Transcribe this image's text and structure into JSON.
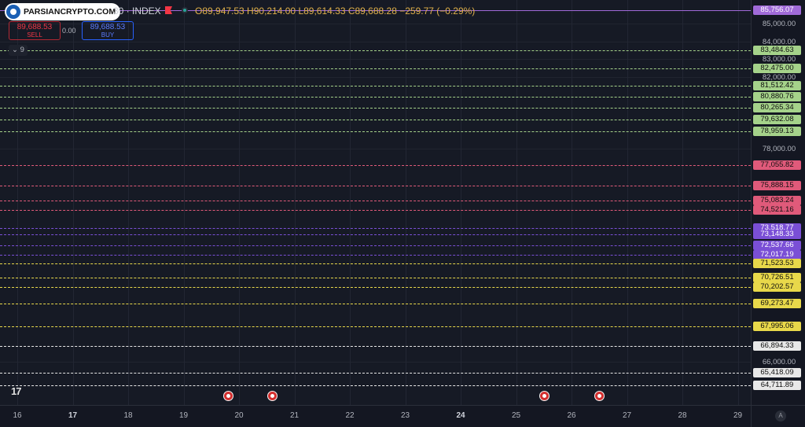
{
  "header": {
    "brand": "PARSIANCRYPTO.COM",
    "symbol": "30 · INDEX",
    "ohlc": "O89,947.53 H90,214.00 L89,614.33 C89,688.28 −259.77 (−0.29%)"
  },
  "trade": {
    "sell_price": "89,688.53",
    "sell_label": "SELL",
    "spread": "0.00",
    "buy_price": "89,688.53",
    "buy_label": "BUY",
    "collapse_count": "9"
  },
  "price_axis": {
    "min": 64250,
    "max": 86150,
    "ticks": [
      "85,000.00",
      "84,000.00",
      "83,000.00",
      "82,000.00",
      "78,000.00",
      "66,000.00"
    ],
    "tick_values": [
      85000,
      84000,
      83000,
      82000,
      78000,
      66000
    ]
  },
  "levels": [
    {
      "label": "85,756.07",
      "value": 85756.07,
      "color": "#a06ad8",
      "style": "solid"
    },
    {
      "label": "83,484.63",
      "value": 83484.63,
      "color": "#a5d28a"
    },
    {
      "label": "82,475.00",
      "value": 82475.0,
      "color": "#a5d28a"
    },
    {
      "label": "81,512.42",
      "value": 81512.42,
      "color": "#a5d28a"
    },
    {
      "label": "80,880.76",
      "value": 80880.76,
      "color": "#a5d28a"
    },
    {
      "label": "80,265.34",
      "value": 80265.34,
      "color": "#a5d28a"
    },
    {
      "label": "79,632.08",
      "value": 79632.08,
      "color": "#a5d28a"
    },
    {
      "label": "78,959.13",
      "value": 78959.13,
      "color": "#a5d28a"
    },
    {
      "label": "77,055.82",
      "value": 77055.82,
      "color": "#e05a7a"
    },
    {
      "label": "75,888.15",
      "value": 75888.15,
      "color": "#e05a7a"
    },
    {
      "label": "75,083.24",
      "value": 75083.24,
      "color": "#e05a7a"
    },
    {
      "label": "74,521.16",
      "value": 74521.16,
      "color": "#e05a7a"
    },
    {
      "label": "73,518.77",
      "value": 73518.77,
      "color": "#7a4fd6"
    },
    {
      "label": "73,148.33",
      "value": 73148.33,
      "color": "#7a4fd6"
    },
    {
      "label": "72,537.66",
      "value": 72537.66,
      "color": "#7a4fd6"
    },
    {
      "label": "72,017.19",
      "value": 72017.19,
      "color": "#7a4fd6"
    },
    {
      "label": "71,523.53",
      "value": 71523.53,
      "color": "#e8d84a"
    },
    {
      "label": "70,726.51",
      "value": 70726.51,
      "color": "#e8d84a"
    },
    {
      "label": "70,202.57",
      "value": 70202.57,
      "color": "#e8d84a"
    },
    {
      "label": "69,273.47",
      "value": 69273.47,
      "color": "#e8d84a"
    },
    {
      "label": "67,995.06",
      "value": 67995.06,
      "color": "#e8d84a"
    },
    {
      "label": "66,894.33",
      "value": 66894.33,
      "color": "#e8e8e8"
    },
    {
      "label": "65,418.09",
      "value": 65418.09,
      "color": "#e8e8e8"
    },
    {
      "label": "64,711.89",
      "value": 64711.89,
      "color": "#e8e8e8"
    }
  ],
  "time_axis": {
    "labels": [
      "16",
      "17",
      "18",
      "19",
      "20",
      "21",
      "22",
      "23",
      "24",
      "25",
      "26",
      "27",
      "28",
      "29"
    ],
    "bold": [
      "17",
      "24"
    ],
    "auto_label": "A"
  },
  "events": [
    {
      "day": "19.8"
    },
    {
      "day": "20.6"
    },
    {
      "day": "25.5"
    },
    {
      "day": "26.5"
    }
  ]
}
